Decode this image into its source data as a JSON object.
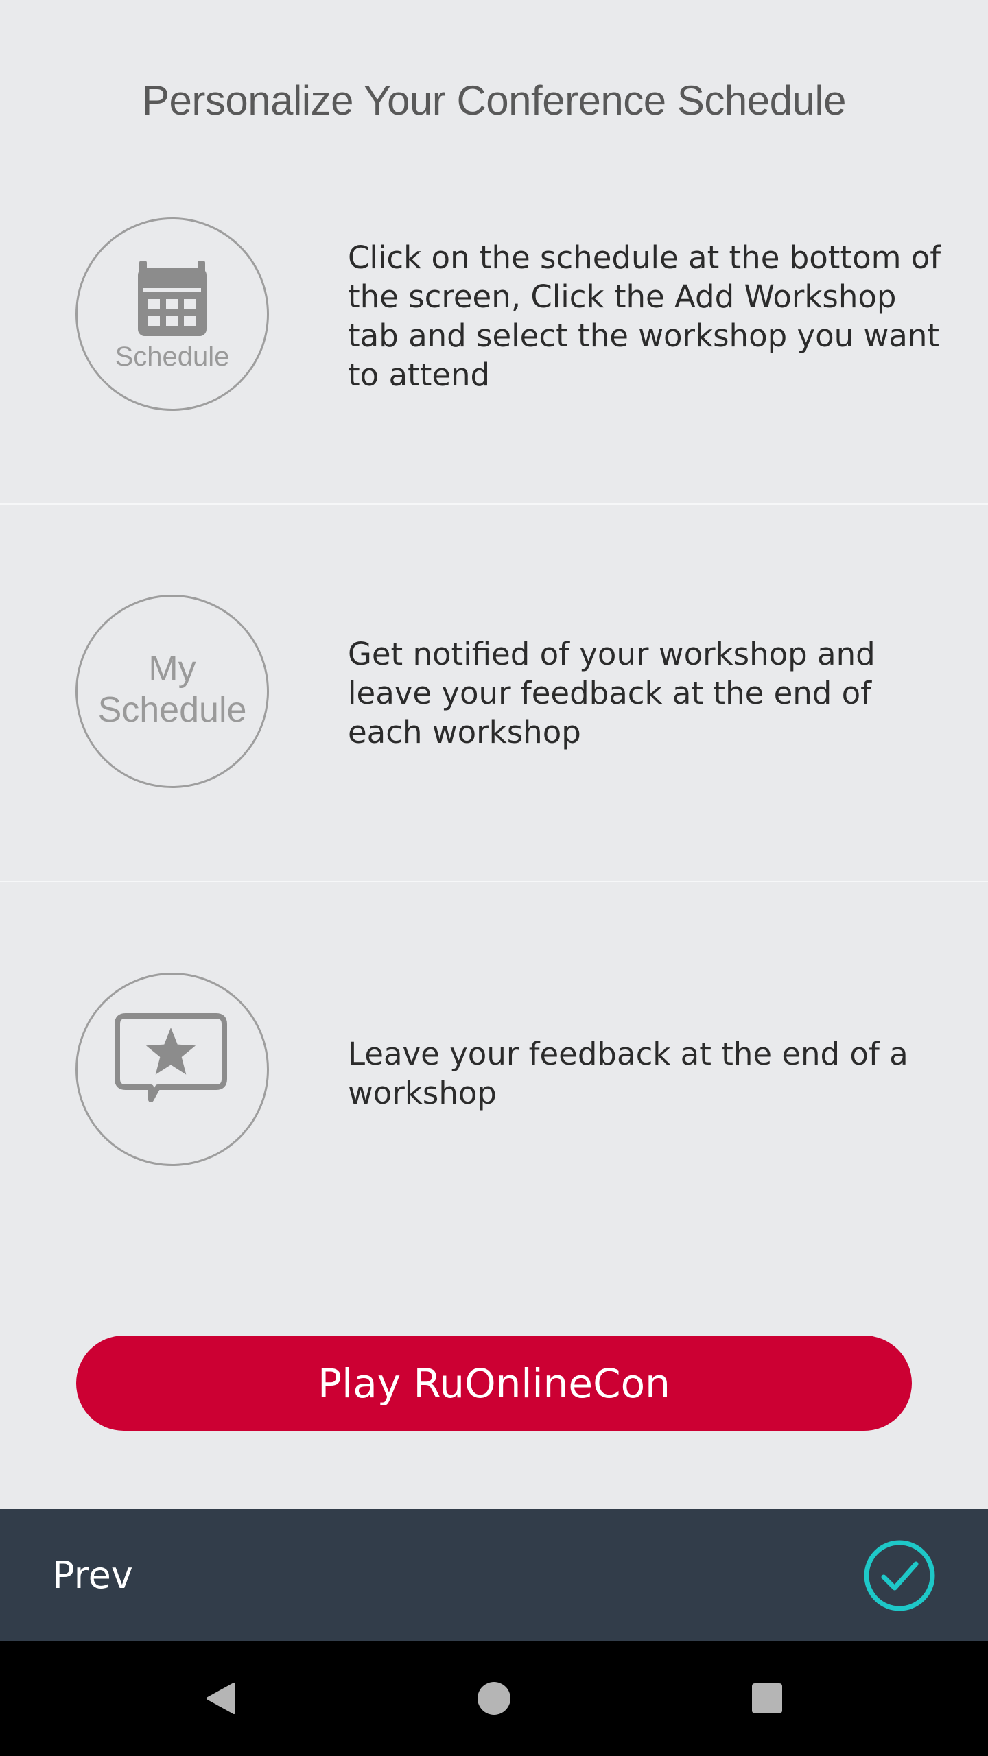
{
  "page": {
    "title": "Personalize Your Conference Schedule"
  },
  "sections": [
    {
      "icon": "calendar-icon",
      "icon_label": "Schedule",
      "description": "Click on the schedule at the bottom of the screen, Click the Add Workshop tab and select the workshop you want to attend"
    },
    {
      "icon": "my-schedule-icon",
      "icon_label_line1": "My",
      "icon_label_line2": "Schedule",
      "description": "Get notified of your workshop and leave your feedback at the end of each workshop"
    },
    {
      "icon": "feedback-star-icon",
      "description": "Leave your feedback at the end of a workshop"
    }
  ],
  "play_button": {
    "label": "Play RuOnlineCon",
    "color": "#cc0033"
  },
  "bottom_bar": {
    "prev_label": "Prev",
    "done_icon": "check-circle-icon",
    "accent_color": "#1ec8c8",
    "background": "#323d4a"
  },
  "system_nav": {
    "back_icon": "back-triangle-icon",
    "home_icon": "home-circle-icon",
    "recents_icon": "recents-square-icon"
  }
}
